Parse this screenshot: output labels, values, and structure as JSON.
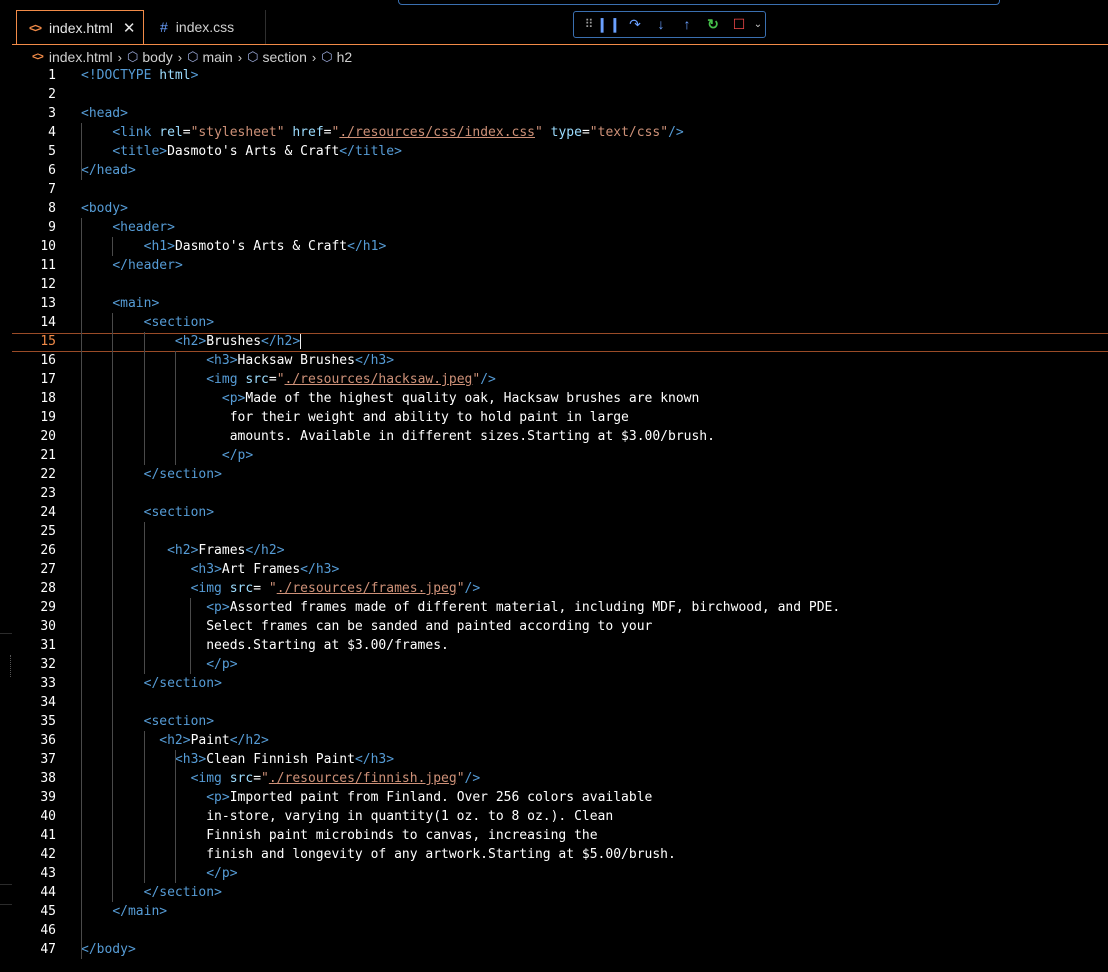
{
  "tabs": [
    {
      "label": "index.html",
      "icon": "html-file-icon",
      "active": true
    },
    {
      "label": "index.css",
      "icon": "css-file-icon",
      "active": false
    }
  ],
  "breadcrumbs": [
    "index.html",
    "body",
    "main",
    "section",
    "h2"
  ],
  "debug_toolbar": [
    "drag-handle",
    "pause",
    "step-over",
    "step-into",
    "step-out",
    "restart",
    "stop"
  ],
  "editor": {
    "active_line": 15,
    "lines": [
      "<!DOCTYPE html>",
      "",
      "<head>",
      "    <link rel=\"stylesheet\" href=\"./resources/css/index.css\" type=\"text/css\"/>",
      "    <title>Dasmoto's Arts & Craft</title>",
      "</head>",
      "",
      "<body>",
      "    <header>",
      "        <h1>Dasmoto's Arts & Craft</h1>",
      "    </header>",
      "",
      "    <main>",
      "        <section>",
      "            <h2>Brushes</h2>",
      "                <h3>Hacksaw Brushes</h3>",
      "                <img src=\"./resources/hacksaw.jpeg\"/>",
      "                  <p>Made of the highest quality oak, Hacksaw brushes are known",
      "                   for their weight and ability to hold paint in large",
      "                   amounts. Available in different sizes.Starting at $3.00/brush.",
      "                  </p>",
      "        </section>",
      "",
      "        <section>",
      "",
      "           <h2>Frames</h2>",
      "              <h3>Art Frames</h3>",
      "              <img src= \"./resources/frames.jpeg\"/>",
      "                <p>Assorted frames made of different material, including MDF, birchwood, and PDE.",
      "                Select frames can be sanded and painted according to your",
      "                needs.Starting at $3.00/frames.",
      "                </p>",
      "        </section>",
      "",
      "        <section>",
      "          <h2>Paint</h2>",
      "            <h3>Clean Finnish Paint</h3>",
      "              <img src=\"./resources/finnish.jpeg\"/>",
      "                <p>Imported paint from Finland. Over 256 colors available",
      "                in-store, varying in quantity(1 oz. to 8 oz.). Clean",
      "                Finnish paint microbinds to canvas, increasing the",
      "                finish and longevity of any artwork.Starting at $5.00/brush.",
      "                </p>",
      "        </section>",
      "    </main>",
      "",
      "</body>"
    ]
  }
}
